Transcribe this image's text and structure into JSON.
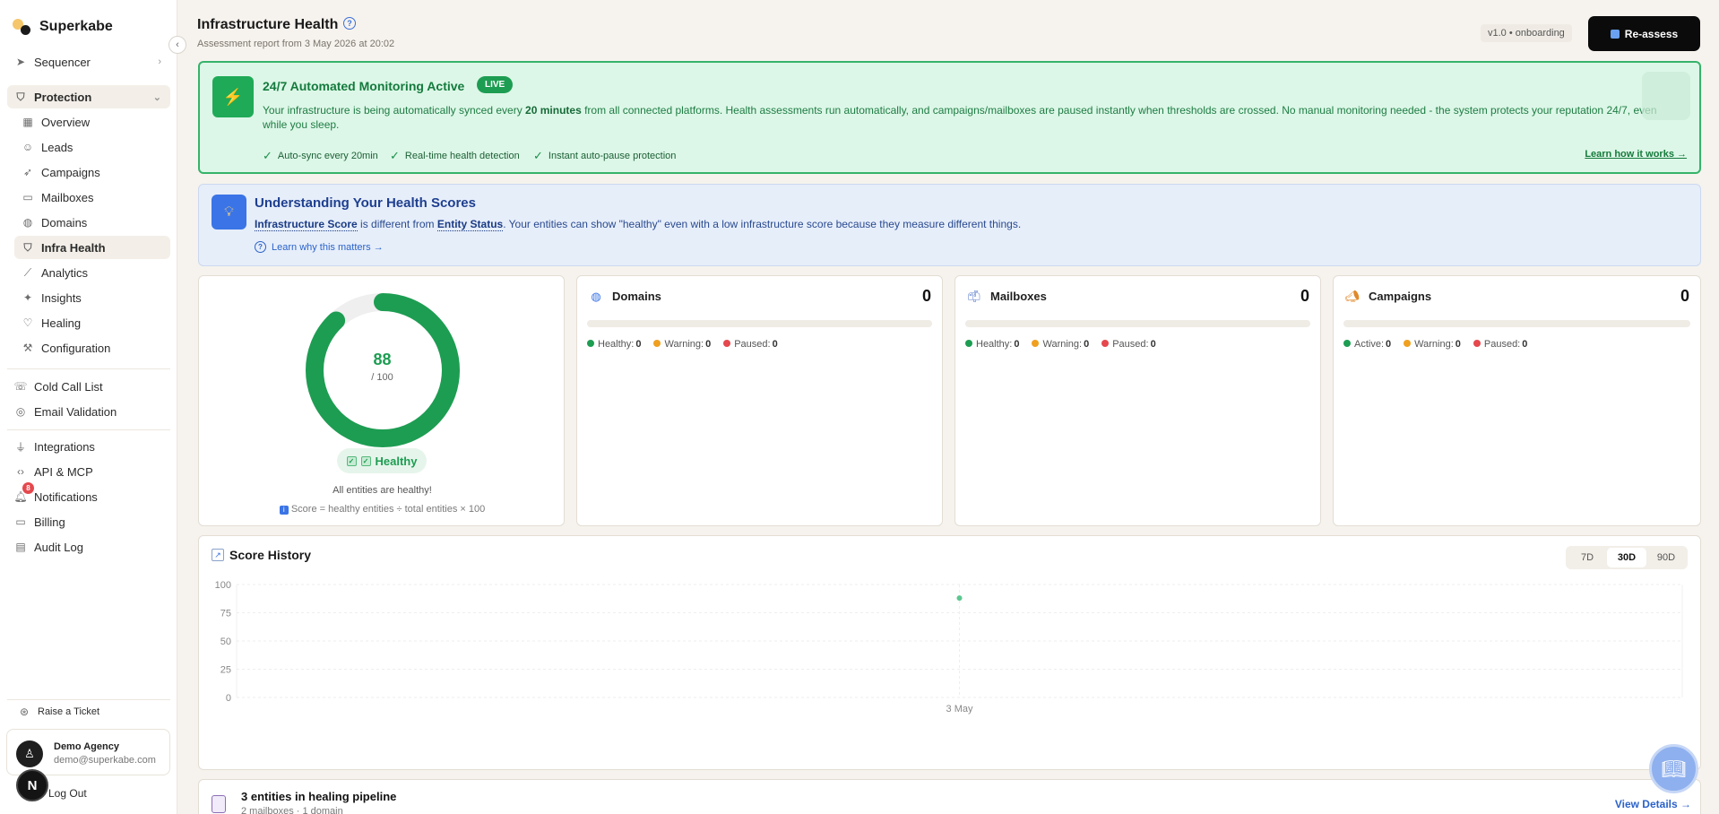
{
  "brand": {
    "name": "Superkabe"
  },
  "sidebar": {
    "sequencer": "Sequencer",
    "protection": "Protection",
    "protection_items": [
      {
        "label": "Overview",
        "icon": "grid-icon"
      },
      {
        "label": "Leads",
        "icon": "users-icon"
      },
      {
        "label": "Campaigns",
        "icon": "send-icon"
      },
      {
        "label": "Mailboxes",
        "icon": "mailbox-icon"
      },
      {
        "label": "Domains",
        "icon": "globe-icon"
      },
      {
        "label": "Infra Health",
        "icon": "shield-check-icon"
      },
      {
        "label": "Analytics",
        "icon": "chart-line-icon"
      },
      {
        "label": "Insights",
        "icon": "sparkle-icon"
      },
      {
        "label": "Healing",
        "icon": "heart-icon"
      },
      {
        "label": "Configuration",
        "icon": "wrench-icon"
      }
    ],
    "tools": [
      {
        "label": "Cold Call List",
        "icon": "phone-icon"
      },
      {
        "label": "Email Validation",
        "icon": "check-circle-icon"
      }
    ],
    "system": [
      {
        "label": "Integrations",
        "icon": "plug-icon"
      },
      {
        "label": "API & MCP",
        "icon": "code-icon"
      },
      {
        "label": "Notifications",
        "icon": "bell-icon",
        "badge": "8"
      },
      {
        "label": "Billing",
        "icon": "card-icon"
      },
      {
        "label": "Audit Log",
        "icon": "file-icon"
      }
    ],
    "raise_ticket": "Raise a Ticket",
    "user": {
      "name": "Demo Agency",
      "email": "demo@superkabe.com"
    },
    "logout": "Log Out",
    "floating_initial": "N"
  },
  "header": {
    "title": "Infrastructure Health",
    "subtitle": "Assessment report from 3 May 2026 at 20:02",
    "version": "v1.0 • onboarding",
    "reassess": "Re-assess"
  },
  "monitor": {
    "title": "24/7 Automated Monitoring Active",
    "badge": "LIVE",
    "text_pre": "Your infrastructure is being automatically synced every ",
    "text_bold": "20 minutes",
    "text_post": " from all connected platforms. Health assessments run automatically, and campaigns/mailboxes are paused instantly when thresholds are crossed. No manual monitoring needed - the system protects your reputation 24/7, even while you sleep.",
    "features": [
      "Auto-sync every 20min",
      "Real-time health detection",
      "Instant auto-pause protection"
    ],
    "learn": "Learn how it works →"
  },
  "understand": {
    "title": "Understanding Your Health Scores",
    "term1": "Infrastructure Score",
    "mid1": " is different from ",
    "term2": "Entity Status",
    "rest": ". Your entities can show \"healthy\" even with a low infrastructure score because they measure different things.",
    "link": "Learn why this matters →"
  },
  "score": {
    "value": "88",
    "denominator": "/ 100",
    "fraction": 0.88,
    "status": "Healthy",
    "message": "All entities are healthy!",
    "formula": "Score = healthy entities ÷ total entities × 100",
    "color": "#1d9d52"
  },
  "stats": [
    {
      "title": "Domains",
      "icon": "globe-icon",
      "count": "0",
      "legend": [
        {
          "label": "Healthy:",
          "value": "0",
          "color": "#1d9d52"
        },
        {
          "label": "Warning:",
          "value": "0",
          "color": "#f0a020"
        },
        {
          "label": "Paused:",
          "value": "0",
          "color": "#e5484d"
        }
      ]
    },
    {
      "title": "Mailboxes",
      "icon": "mailbox-icon",
      "count": "0",
      "legend": [
        {
          "label": "Healthy:",
          "value": "0",
          "color": "#1d9d52"
        },
        {
          "label": "Warning:",
          "value": "0",
          "color": "#f0a020"
        },
        {
          "label": "Paused:",
          "value": "0",
          "color": "#e5484d"
        }
      ]
    },
    {
      "title": "Campaigns",
      "icon": "megaphone-icon",
      "count": "0",
      "legend": [
        {
          "label": "Active:",
          "value": "0",
          "color": "#1d9d52"
        },
        {
          "label": "Warning:",
          "value": "0",
          "color": "#f0a020"
        },
        {
          "label": "Paused:",
          "value": "0",
          "color": "#e5484d"
        }
      ]
    }
  ],
  "history": {
    "title": "Score History",
    "ranges": [
      "7D",
      "30D",
      "90D"
    ],
    "active_range": "30D"
  },
  "chart_data": {
    "type": "scatter",
    "title": "Score History",
    "x": [
      "3 May"
    ],
    "y": [
      88
    ],
    "ylim": [
      0,
      100
    ],
    "yticks": [
      "100",
      "75",
      "50",
      "25",
      "0"
    ],
    "grid": true,
    "color": "#5cc790"
  },
  "pipeline": {
    "title": "3 entities in healing pipeline",
    "subtitle": "2 mailboxes · 1 domain",
    "link": "View Details →"
  }
}
